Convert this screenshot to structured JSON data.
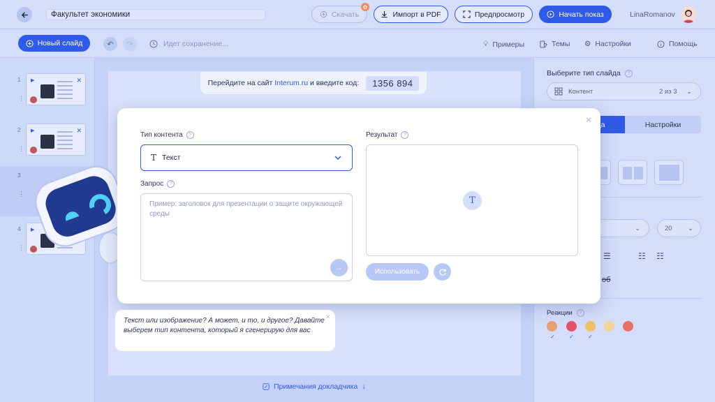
{
  "header": {
    "presentation_title": "Факультет экономики",
    "download_label": "Скачать",
    "import_pdf_label": "Импорт в PDF",
    "preview_label": "Предпросмотр",
    "start_show_label": "Начать показ",
    "username": "LinaRomanov"
  },
  "toolbar": {
    "new_slide_label": "Новый слайд",
    "saving_status": "Идет сохранение...",
    "examples_label": "Примеры",
    "themes_label": "Темы",
    "settings_label": "Настройки",
    "help_label": "Помощь"
  },
  "slides": [
    {
      "number": "1"
    },
    {
      "number": "2"
    },
    {
      "number": "3"
    },
    {
      "number": "4"
    }
  ],
  "canvas": {
    "join_prefix": "Перейдите на сайт",
    "join_site": "Interum.ru",
    "join_suffix": "и введите код:",
    "join_code": "1356 894",
    "speaker_notes_label": "Примечания докладчика"
  },
  "right_panel": {
    "slide_type_label": "Выберите тип слайда",
    "slide_type_value": "Контент",
    "slide_type_counter": "2 из 3",
    "tab_active": "да",
    "tab_settings": "Настройки",
    "font_size_value": "20",
    "strike_text": "об",
    "reactions_label": "Реакции"
  },
  "modal": {
    "content_type_label": "Тип контента",
    "content_type_value": "Текст",
    "request_label": "Запрос",
    "request_placeholder": "Пример: заголовок для презентации о защите окружающей среды",
    "result_label": "Результат",
    "use_label": "Использовать"
  },
  "tooltip": {
    "text": "Текст или изображение? А может, и то, и другое? Давайте выберем тип контента, который я сгенерирую для вас"
  },
  "colors": {
    "accent": "#2f5be8",
    "background": "#c9d6f8",
    "modal_bg": "#ffffff"
  }
}
